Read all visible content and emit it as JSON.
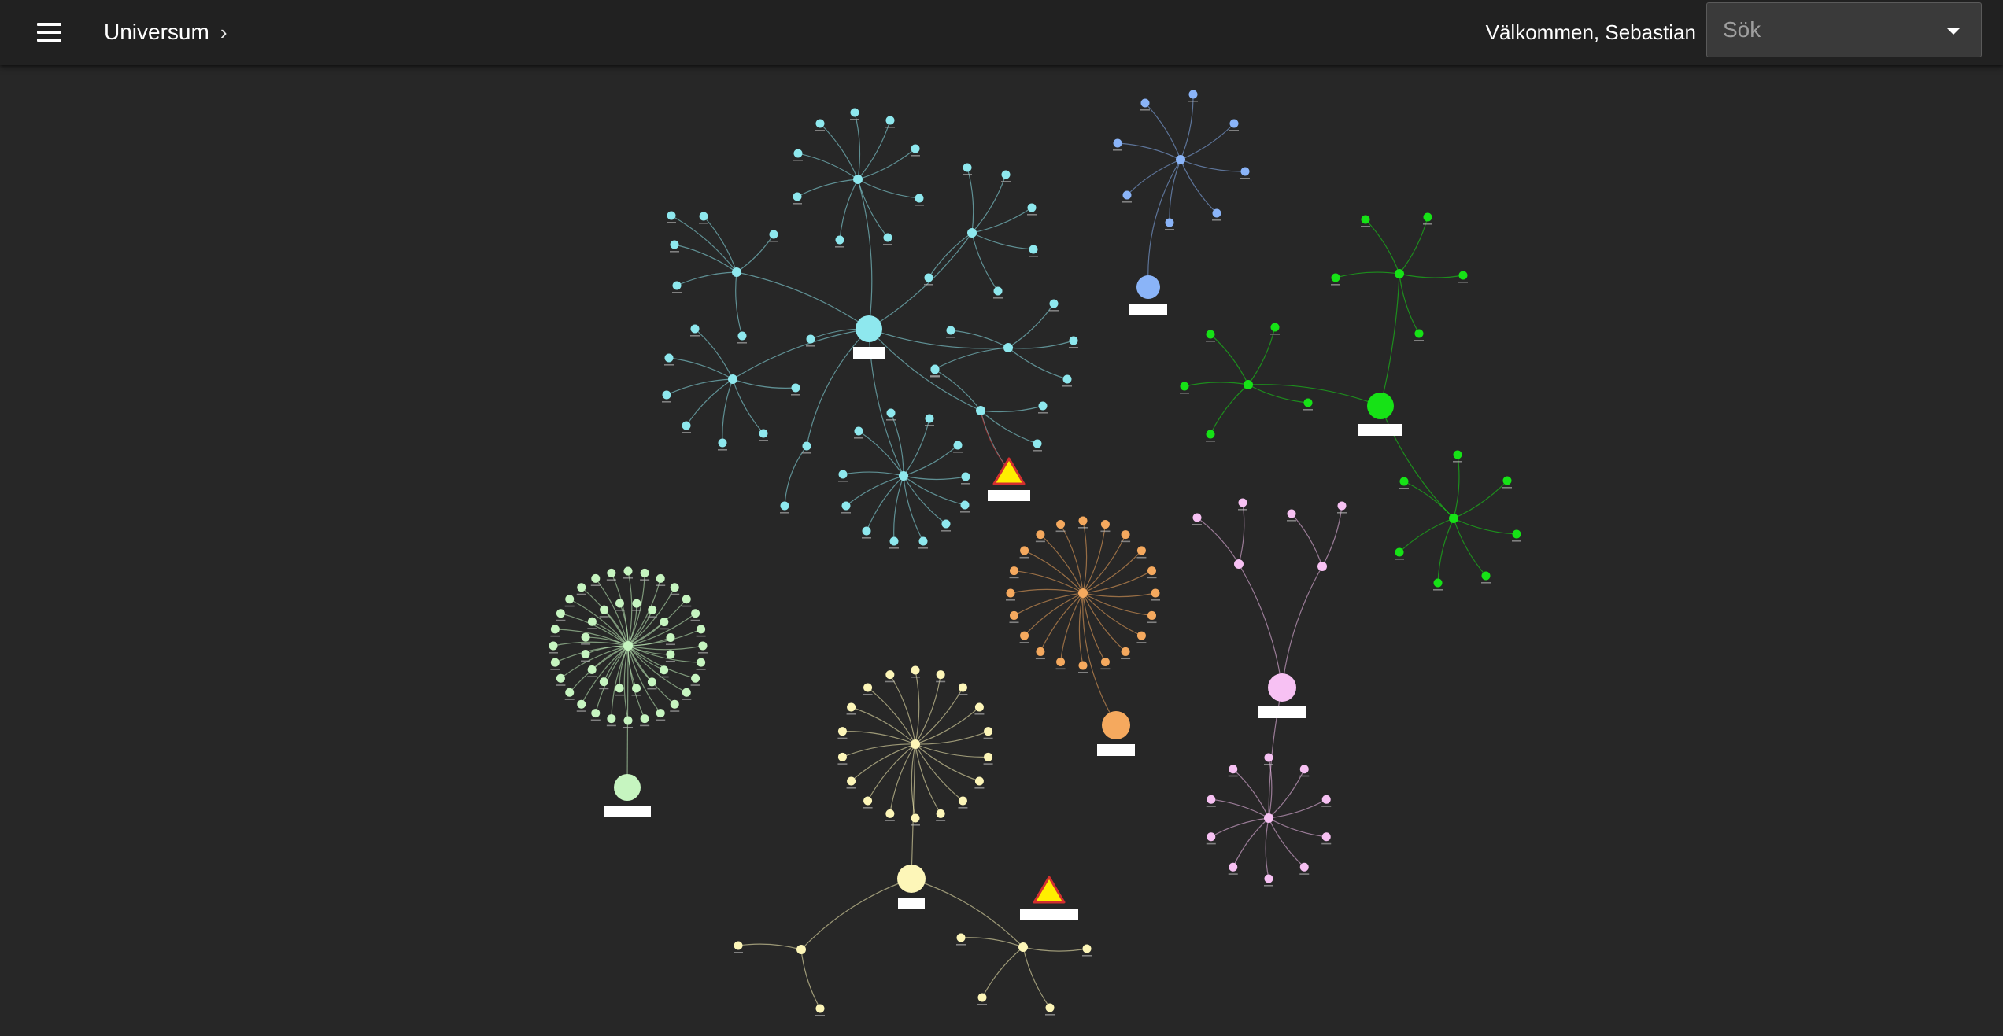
{
  "appbar": {
    "title": "Universum",
    "breadcrumb_sep": "›",
    "welcome": "Välkommen, Sebastian",
    "search_placeholder": "Sök"
  },
  "colors": {
    "background": "#272727",
    "appbar": "#212121",
    "label_box": "#ffffff",
    "warning_fill": "#ffee00",
    "warning_stroke": "#d32f2f",
    "clusters": {
      "cyan": "#8ee8ee",
      "blue": "#8ab4f8",
      "green": "#16e216",
      "lightgreen": "#c6f5c0",
      "orange": "#f5a95e",
      "pink": "#f7c1f3",
      "yellow": "#fdf6b8"
    }
  },
  "icons": {
    "menu": "menu-icon",
    "dropdown": "chevron-down-icon",
    "warning": "warning-icon"
  }
}
